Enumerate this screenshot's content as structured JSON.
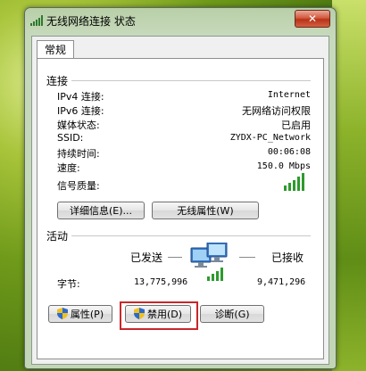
{
  "window": {
    "title": "无线网络连接 状态",
    "close_symbol": "✕"
  },
  "tabs": [
    {
      "label": "常规"
    }
  ],
  "connection": {
    "group_label": "连接",
    "rows": [
      {
        "label": "IPv4 连接:",
        "value": "Internet"
      },
      {
        "label": "IPv6 连接:",
        "value": "无网络访问权限"
      },
      {
        "label": "媒体状态:",
        "value": "已启用"
      },
      {
        "label": "SSID:",
        "value": "ZYDX-PC_Network"
      },
      {
        "label": "持续时间:",
        "value": "00:06:08"
      },
      {
        "label": "速度:",
        "value": "150.0 Mbps"
      }
    ],
    "signal_label": "信号质量:",
    "signal_bars": 5,
    "details_button": "详细信息(E)...",
    "wireless_props_button": "无线属性(W)"
  },
  "activity": {
    "group_label": "活动",
    "sent_label": "已发送",
    "received_label": "已接收",
    "bytes_label": "字节:",
    "bytes_sent": "13,775,996",
    "bytes_received": "9,471,296"
  },
  "actions": {
    "properties_button": "属性(P)",
    "disable_button": "禁用(D)",
    "diagnose_button": "诊断(G)"
  },
  "icons": {
    "title": "wireless-signal-icon",
    "signal": "signal-strength-icon",
    "network": "network-computers-icon",
    "shield": "uac-shield-icon"
  },
  "colors": {
    "highlight_box": "#c8272a",
    "signal_green": "#2e9a2e"
  }
}
